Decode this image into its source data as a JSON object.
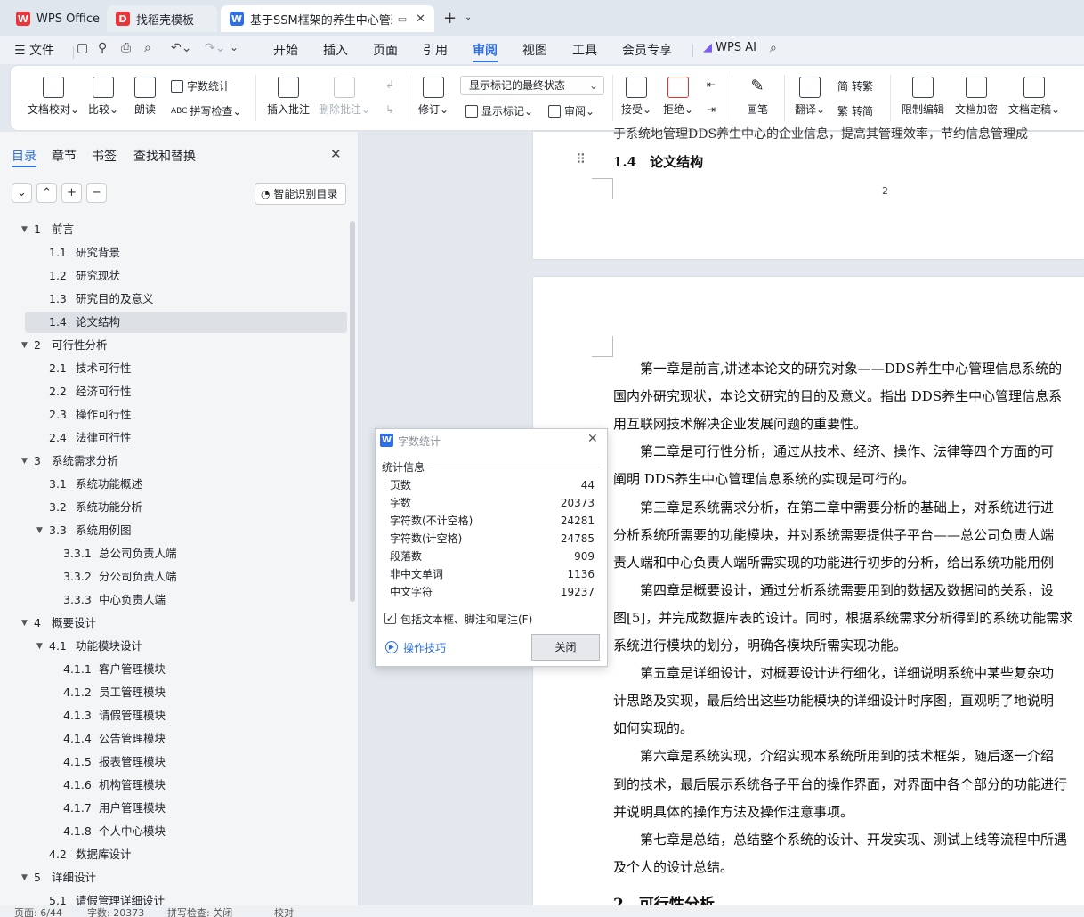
{
  "tabs": [
    {
      "label": "WPS Office",
      "icon": "wps-logo-icon"
    },
    {
      "label": "找稻壳模板",
      "icon": "docer-logo-icon"
    },
    {
      "label": "基于SSM框架的养生中心管理",
      "icon": "word-doc-icon"
    }
  ],
  "menubar": {
    "file": "文件",
    "items": [
      "开始",
      "插入",
      "页面",
      "引用",
      "审阅",
      "视图",
      "工具",
      "会员专享"
    ],
    "active": "审阅",
    "ai": "WPS AI"
  },
  "ribbon": {
    "doc_check": "文档校对",
    "compare": "比较",
    "read_aloud": "朗读",
    "word_count": "字数统计",
    "spell_check": "拼写检查",
    "insert_comment": "插入批注",
    "delete_comment": "删除批注",
    "track_changes": "修订",
    "markup_state": "显示标记的最终状态",
    "show_markup": "显示标记",
    "review_pane": "审阅",
    "accept": "接受",
    "reject": "拒绝",
    "pen": "画笔",
    "translate": "翻译",
    "to_traditional": "转繁",
    "to_simplified": "转简",
    "restrict_edit": "限制编辑",
    "encrypt": "文档加密",
    "finalize": "文档定稿"
  },
  "panel": {
    "tabs": [
      "目录",
      "章节",
      "书签",
      "查找和替换"
    ],
    "smart_toc": "智能识别目录",
    "toc": [
      {
        "num": "1",
        "text": "前言",
        "level": 1
      },
      {
        "num": "1.1",
        "text": "研究背景",
        "level": 2
      },
      {
        "num": "1.2",
        "text": "研究现状",
        "level": 2
      },
      {
        "num": "1.3",
        "text": "研究目的及意义",
        "level": 2
      },
      {
        "num": "1.4",
        "text": "论文结构",
        "level": 2,
        "selected": true
      },
      {
        "num": "2",
        "text": "可行性分析",
        "level": 1
      },
      {
        "num": "2.1",
        "text": "技术可行性",
        "level": 2
      },
      {
        "num": "2.2",
        "text": "经济可行性",
        "level": 2
      },
      {
        "num": "2.3",
        "text": "操作可行性",
        "level": 2
      },
      {
        "num": "2.4",
        "text": "法律可行性",
        "level": 2
      },
      {
        "num": "3",
        "text": "系统需求分析",
        "level": 1
      },
      {
        "num": "3.1",
        "text": "系统功能概述",
        "level": 2
      },
      {
        "num": "3.2",
        "text": "系统功能分析",
        "level": 2
      },
      {
        "num": "3.3",
        "text": "系统用例图",
        "level": 2,
        "expand": true
      },
      {
        "num": "3.3.1",
        "text": "总公司负责人端",
        "level": 3
      },
      {
        "num": "3.3.2",
        "text": "分公司负责人端",
        "level": 3
      },
      {
        "num": "3.3.3",
        "text": "中心负责人端",
        "level": 3
      },
      {
        "num": "4",
        "text": "概要设计",
        "level": 1
      },
      {
        "num": "4.1",
        "text": "功能模块设计",
        "level": 2,
        "expand": true
      },
      {
        "num": "4.1.1",
        "text": "客户管理模块",
        "level": 3
      },
      {
        "num": "4.1.2",
        "text": "员工管理模块",
        "level": 3
      },
      {
        "num": "4.1.3",
        "text": "请假管理模块",
        "level": 3
      },
      {
        "num": "4.1.4",
        "text": "公告管理模块",
        "level": 3
      },
      {
        "num": "4.1.5",
        "text": "报表管理模块",
        "level": 3
      },
      {
        "num": "4.1.6",
        "text": "机构管理模块",
        "level": 3
      },
      {
        "num": "4.1.7",
        "text": "用户管理模块",
        "level": 3
      },
      {
        "num": "4.1.8",
        "text": "个人中心模块",
        "level": 3
      },
      {
        "num": "4.2",
        "text": "数据库设计",
        "level": 2
      },
      {
        "num": "5",
        "text": "详细设计",
        "level": 1
      },
      {
        "num": "5.1",
        "text": "请假管理详细设计",
        "level": 2
      }
    ]
  },
  "document": {
    "page1_partial": "于系统地管理DDS养生中心的企业信息，提高其管理效率，节约信息管理成",
    "section_heading": "1.4　论文结构",
    "page_number": "2",
    "paragraphs": [
      "　　第一章是前言,讲述本论文的研究对象——DDS养生中心管理信息系统的",
      "国内外研究现状，本论文研究的目的及意义。指出 DDS养生中心管理信息系",
      "用互联网技术解决企业发展问题的重要性。",
      "　　第二章是可行性分析，通过从技术、经济、操作、法律等四个方面的可",
      "阐明 DDS养生中心管理信息系统的实现是可行的。",
      "　　第三章是系统需求分析，在第二章中需要分析的基础上，对系统进行进",
      "分析系统所需要的功能模块，并对系统需要提供子平台——总公司负责人端",
      "责人端和中心负责人端所需实现的功能进行初步的分析，给出系统功能用例",
      "　　第四章是概要设计，通过分析系统需要用到的数据及数据间的关系，设",
      "图[5]，并完成数据库表的设计。同时，根据系统需求分析得到的系统功能需求",
      "系统进行模块的划分，明确各模块所需实现功能。",
      "　　第五章是详细设计，对概要设计进行细化，详细说明系统中某些复杂功",
      "计思路及实现，最后给出这些功能模块的详细设计时序图，直观明了地说明",
      "如何实现的。",
      "　　第六章是系统实现，介绍实现本系统所用到的技术框架，随后逐一介绍",
      "到的技术，最后展示系统各子平台的操作界面，对界面中各个部分的功能进行",
      "并说明具体的操作方法及操作注意事项。",
      "　　第七章是总结，总结整个系统的设计、开发实现、测试上线等流程中所遇",
      "及个人的设计总结。"
    ],
    "next_heading": "2　可行性分析"
  },
  "dialog": {
    "title": "字数统计",
    "section": "统计信息",
    "rows": [
      {
        "label": "页数",
        "value": "44"
      },
      {
        "label": "字数",
        "value": "20373"
      },
      {
        "label": "字符数(不计空格)",
        "value": "24281"
      },
      {
        "label": "字符数(计空格)",
        "value": "24785"
      },
      {
        "label": "段落数",
        "value": "909"
      },
      {
        "label": "非中文单词",
        "value": "1136"
      },
      {
        "label": "中文字符",
        "value": "19237"
      }
    ],
    "checkbox_label": "包括文本框、脚注和尾注(F)",
    "tips": "操作技巧",
    "close": "关闭"
  },
  "status": {
    "page": "页面: 6/44",
    "words": "字数: 20373",
    "spell": "拼写检查: 关闭",
    "proof": "校对"
  }
}
